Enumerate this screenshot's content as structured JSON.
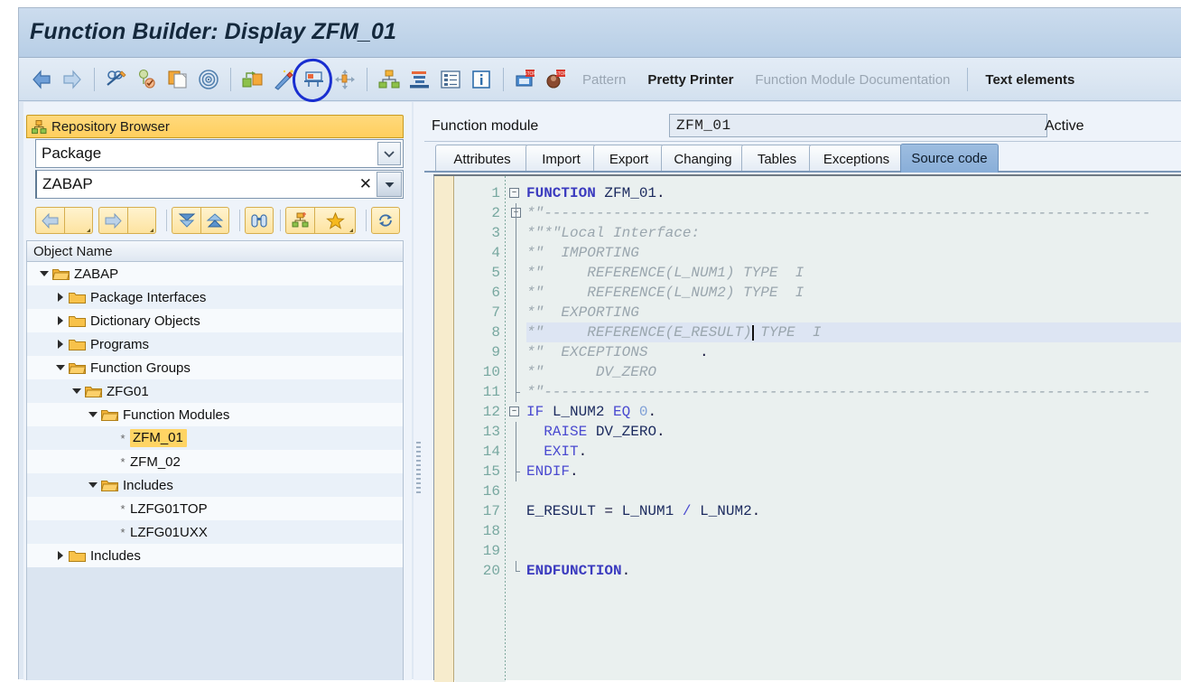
{
  "window": {
    "title": "Function Builder: Display ZFM_01"
  },
  "toolbar": {
    "icons": [
      {
        "name": "back-arrow-icon",
        "title": "Back"
      },
      {
        "name": "forward-arrow-icon",
        "title": "Forward"
      },
      {
        "name": "display-change-icon",
        "title": "Display <-> Change"
      },
      {
        "name": "check-icon",
        "title": "Check"
      },
      {
        "name": "copy-icon",
        "title": "Copy"
      },
      {
        "name": "target-icon",
        "title": "Where-used list"
      },
      {
        "name": "activate-icon",
        "title": "Activate"
      },
      {
        "name": "wand-icon",
        "title": "Generate"
      },
      {
        "name": "test-icon",
        "title": "Test"
      },
      {
        "name": "expand-icon",
        "title": "Navigate"
      },
      {
        "name": "hierarchy-icon",
        "title": "Object navigator"
      },
      {
        "name": "stack-icon",
        "title": "Overview"
      },
      {
        "name": "list-icon",
        "title": "List"
      },
      {
        "name": "info-icon",
        "title": "Information"
      },
      {
        "name": "debug-icon",
        "title": "Debugging"
      },
      {
        "name": "breakpoint-icon",
        "title": "Breakpoint"
      }
    ],
    "text_buttons": [
      {
        "label": "Pattern",
        "enabled": false
      },
      {
        "label": "Pretty Printer",
        "enabled": true
      },
      {
        "label": "Function Module Documentation",
        "enabled": false
      },
      {
        "label": "Text elements",
        "enabled": true
      }
    ],
    "annotation": {
      "shape": "hand-drawn-blue-ellipse",
      "color": "#1a2fd0",
      "around_icon": "test-icon"
    }
  },
  "sidebar": {
    "header": {
      "title": "Repository Browser",
      "icon": "repository-browser-icon"
    },
    "type_select": {
      "value": "Package",
      "icon": "chevron-down-icon"
    },
    "search": {
      "value": "ZABAP",
      "clear_icon": "close-icon",
      "dropdown_icon": "dropdown-arrow-icon"
    },
    "buttons": [
      {
        "name": "back-button",
        "icon": "back-arrow-icon"
      },
      {
        "name": "back-history-button",
        "icon": "small-triangle-icon"
      },
      {
        "name": "forward-button",
        "icon": "forward-arrow-icon"
      },
      {
        "name": "forward-history-button",
        "icon": "small-triangle-icon"
      },
      {
        "name": "expand-all-button",
        "icon": "expand-all-icon"
      },
      {
        "name": "collapse-all-button",
        "icon": "collapse-all-icon"
      },
      {
        "name": "find-button",
        "icon": "binoculars-icon"
      },
      {
        "name": "other-object-button",
        "icon": "hierarchy-plus-icon"
      },
      {
        "name": "favorites-button",
        "icon": "star-icon"
      },
      {
        "name": "refresh-button",
        "icon": "refresh-icon"
      }
    ],
    "tree_header": "Object Name",
    "tree": [
      {
        "label": "ZABAP",
        "depth": 0,
        "state": "open",
        "kind": "folder-open"
      },
      {
        "label": "Package Interfaces",
        "depth": 1,
        "state": "closed",
        "kind": "folder"
      },
      {
        "label": "Dictionary Objects",
        "depth": 1,
        "state": "closed",
        "kind": "folder"
      },
      {
        "label": "Programs",
        "depth": 1,
        "state": "closed",
        "kind": "folder"
      },
      {
        "label": "Function Groups",
        "depth": 1,
        "state": "open",
        "kind": "folder-open"
      },
      {
        "label": "ZFG01",
        "depth": 2,
        "state": "open",
        "kind": "folder-open"
      },
      {
        "label": "Function Modules",
        "depth": 3,
        "state": "open",
        "kind": "folder-open"
      },
      {
        "label": "ZFM_01",
        "depth": 4,
        "state": "leaf",
        "kind": "leaf",
        "selected": true
      },
      {
        "label": "ZFM_02",
        "depth": 4,
        "state": "leaf",
        "kind": "leaf"
      },
      {
        "label": "Includes",
        "depth": 3,
        "state": "open",
        "kind": "folder-open"
      },
      {
        "label": "LZFG01TOP",
        "depth": 4,
        "state": "leaf",
        "kind": "leaf"
      },
      {
        "label": "LZFG01UXX",
        "depth": 4,
        "state": "leaf",
        "kind": "leaf"
      },
      {
        "label": "Includes",
        "depth": 1,
        "state": "closed",
        "kind": "folder"
      }
    ]
  },
  "main": {
    "function_module_label": "Function module",
    "function_module_value": "ZFM_01",
    "status": "Active",
    "tabs": [
      {
        "label": "Attributes",
        "active": false
      },
      {
        "label": "Import",
        "active": false
      },
      {
        "label": "Export",
        "active": false
      },
      {
        "label": "Changing",
        "active": false
      },
      {
        "label": "Tables",
        "active": false
      },
      {
        "label": "Exceptions",
        "active": false
      },
      {
        "label": "Source code",
        "active": true
      }
    ],
    "editor": {
      "current_line": 8,
      "total_lines": 20,
      "lines": [
        {
          "n": 1,
          "fold": "minus-root",
          "tokens": [
            {
              "t": "FUNCTION",
              "c": "kw"
            },
            {
              "t": " ",
              "c": "plain"
            },
            {
              "t": "ZFM_01",
              "c": "id"
            },
            {
              "t": ".",
              "c": "punct"
            }
          ]
        },
        {
          "n": 2,
          "fold": "minus-child",
          "tokens": [
            {
              "t": "*\"----------------------------------------------------------------------",
              "c": "cmt"
            }
          ]
        },
        {
          "n": 3,
          "fold": "bar",
          "tokens": [
            {
              "t": "*\"*\"Local Interface:",
              "c": "cmt"
            }
          ]
        },
        {
          "n": 4,
          "fold": "bar",
          "tokens": [
            {
              "t": "*\"  IMPORTING",
              "c": "cmt"
            }
          ]
        },
        {
          "n": 5,
          "fold": "bar",
          "tokens": [
            {
              "t": "*\"     REFERENCE(L_NUM1) TYPE  I",
              "c": "cmt"
            }
          ]
        },
        {
          "n": 6,
          "fold": "bar",
          "tokens": [
            {
              "t": "*\"     REFERENCE(L_NUM2) TYPE  I",
              "c": "cmt"
            }
          ]
        },
        {
          "n": 7,
          "fold": "bar",
          "tokens": [
            {
              "t": "*\"  EXPORTING",
              "c": "cmt"
            }
          ]
        },
        {
          "n": 8,
          "fold": "bar",
          "tokens": [
            {
              "t": "*\"     REFERENCE(E_RESULT) TYPE  I",
              "c": "cmt"
            }
          ]
        },
        {
          "n": 9,
          "fold": "bar",
          "tokens": [
            {
              "t": "*\"  EXCEPTIONS",
              "c": "cmt"
            },
            {
              "t": "      .",
              "c": "punct"
            }
          ]
        },
        {
          "n": 10,
          "fold": "bar",
          "tokens": [
            {
              "t": "*\"      DV_ZERO",
              "c": "cmt"
            }
          ]
        },
        {
          "n": 11,
          "fold": "bar-end",
          "tokens": [
            {
              "t": "*\"----------------------------------------------------------------------",
              "c": "cmt"
            }
          ]
        },
        {
          "n": 12,
          "fold": "minus-root",
          "tokens": [
            {
              "t": "IF",
              "c": "kw2"
            },
            {
              "t": " ",
              "c": "plain"
            },
            {
              "t": "L_NUM2",
              "c": "id"
            },
            {
              "t": " ",
              "c": "plain"
            },
            {
              "t": "EQ",
              "c": "kw2"
            },
            {
              "t": " ",
              "c": "plain"
            },
            {
              "t": "0",
              "c": "num"
            },
            {
              "t": ".",
              "c": "punct"
            }
          ]
        },
        {
          "n": 13,
          "fold": "bar",
          "tokens": [
            {
              "t": "  ",
              "c": "plain"
            },
            {
              "t": "RAISE",
              "c": "kw2"
            },
            {
              "t": " ",
              "c": "plain"
            },
            {
              "t": "DV_ZERO",
              "c": "id"
            },
            {
              "t": ".",
              "c": "punct"
            }
          ]
        },
        {
          "n": 14,
          "fold": "bar",
          "tokens": [
            {
              "t": "  ",
              "c": "plain"
            },
            {
              "t": "EXIT",
              "c": "kw2"
            },
            {
              "t": ".",
              "c": "punct"
            }
          ]
        },
        {
          "n": 15,
          "fold": "bar-end",
          "tokens": [
            {
              "t": "ENDIF",
              "c": "kw2"
            },
            {
              "t": ".",
              "c": "punct"
            }
          ]
        },
        {
          "n": 16,
          "fold": "none",
          "tokens": []
        },
        {
          "n": 17,
          "fold": "none",
          "tokens": [
            {
              "t": "E_RESULT",
              "c": "id"
            },
            {
              "t": " = ",
              "c": "punct"
            },
            {
              "t": "L_NUM1",
              "c": "id"
            },
            {
              "t": " ",
              "c": "plain"
            },
            {
              "t": "/",
              "c": "kw2"
            },
            {
              "t": " ",
              "c": "plain"
            },
            {
              "t": "L_NUM2",
              "c": "id"
            },
            {
              "t": ".",
              "c": "punct"
            }
          ]
        },
        {
          "n": 18,
          "fold": "none",
          "tokens": []
        },
        {
          "n": 19,
          "fold": "none",
          "tokens": []
        },
        {
          "n": 20,
          "fold": "end-tick",
          "tokens": [
            {
              "t": "ENDFUNCTION",
              "c": "kw"
            },
            {
              "t": ".",
              "c": "punct"
            }
          ]
        }
      ]
    }
  },
  "colors": {
    "title_bar": "#c3d6ea",
    "accent_selection": "#ffd464",
    "tab_active": "#89aed8",
    "annotation": "#1a2fd0",
    "comment": "#9aa6ae",
    "keyword": "#3b3bbf"
  }
}
